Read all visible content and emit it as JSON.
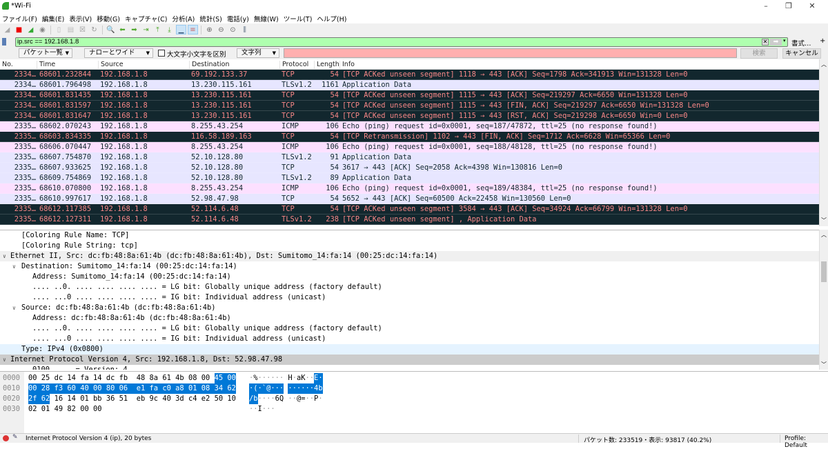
{
  "window": {
    "title": "*Wi-Fi",
    "controls": [
      "–",
      "❐",
      "✕"
    ]
  },
  "menu": [
    "ファイル(F)",
    "編集(E)",
    "表示(V)",
    "移動(G)",
    "キャプチャ(C)",
    "分析(A)",
    "統計(S)",
    "電話(y)",
    "無線(W)",
    "ツール(T)",
    "ヘルプ(H)"
  ],
  "toolbar": [
    "shark-fin-start",
    "stop-capture",
    "restart-capture",
    "capture-options",
    "open-file",
    "file",
    "close-file",
    "reload",
    "find-packet",
    "go-back",
    "go-forward",
    "go-to-packet",
    "go-first",
    "go-last",
    "auto-scroll",
    "colorize",
    "zoom-in",
    "zoom-out",
    "zoom-normal",
    "resize-columns"
  ],
  "filter": {
    "value": "ip.src == 192.168.1.8",
    "format_label": "書式…",
    "add_label": "+",
    "color": "#afffaf"
  },
  "find": {
    "scope": "パケット一覧",
    "charset": "ナローとワイド",
    "case_label": "大文字小文字を区別",
    "case_checked": false,
    "type": "文字列",
    "value": "",
    "search_label": "検索",
    "cancel_label": "キャンセル",
    "input_color": "#ffafaf"
  },
  "packet_list": {
    "columns": [
      "No.",
      "Time",
      "Source",
      "Destination",
      "Protocol",
      "Length",
      "Info"
    ],
    "colors": {
      "dark_bg": "#12272e",
      "dark_fg": "#f78787",
      "tcp_bg": "#e7e6ff",
      "icmp_bg": "#fce0ff",
      "light_fg": "#12272e"
    },
    "rows": [
      {
        "no": "2334…",
        "time": "68601.232844",
        "src": "192.168.1.8",
        "dst": "69.192.133.37",
        "proto": "TCP",
        "len": "54",
        "info": "[TCP ACKed unseen segment] 1118 → 443 [ACK] Seq=1798 Ack=341913 Win=131328 Len=0",
        "style": "dark"
      },
      {
        "no": "2334…",
        "time": "68601.796498",
        "src": "192.168.1.8",
        "dst": "13.230.115.161",
        "proto": "TLSv1.2",
        "len": "1161",
        "info": "Application Data",
        "style": "tcp"
      },
      {
        "no": "2334…",
        "time": "68601.831435",
        "src": "192.168.1.8",
        "dst": "13.230.115.161",
        "proto": "TCP",
        "len": "54",
        "info": "[TCP ACKed unseen segment] 1115 → 443 [ACK] Seq=219297 Ack=6650 Win=131328 Len=0",
        "style": "dark"
      },
      {
        "no": "2334…",
        "time": "68601.831597",
        "src": "192.168.1.8",
        "dst": "13.230.115.161",
        "proto": "TCP",
        "len": "54",
        "info": "[TCP ACKed unseen segment] 1115 → 443 [FIN, ACK] Seq=219297 Ack=6650 Win=131328 Len=0",
        "style": "dark"
      },
      {
        "no": "2334…",
        "time": "68601.831647",
        "src": "192.168.1.8",
        "dst": "13.230.115.161",
        "proto": "TCP",
        "len": "54",
        "info": "[TCP ACKed unseen segment] 1115 → 443 [RST, ACK] Seq=219298 Ack=6650 Win=0 Len=0",
        "style": "dark"
      },
      {
        "no": "2335…",
        "time": "68602.070243",
        "src": "192.168.1.8",
        "dst": "8.255.43.254",
        "proto": "ICMP",
        "len": "106",
        "info": "Echo (ping) request  id=0x0001, seq=187/47872, ttl=25 (no response found!)",
        "style": "icmp"
      },
      {
        "no": "2335…",
        "time": "68603.834335",
        "src": "192.168.1.8",
        "dst": "116.58.189.163",
        "proto": "TCP",
        "len": "54",
        "info": "[TCP Retransmission] 1102 → 443 [FIN, ACK] Seq=1712 Ack=6628 Win=65366 Len=0",
        "style": "dark"
      },
      {
        "no": "2335…",
        "time": "68606.070447",
        "src": "192.168.1.8",
        "dst": "8.255.43.254",
        "proto": "ICMP",
        "len": "106",
        "info": "Echo (ping) request  id=0x0001, seq=188/48128, ttl=25 (no response found!)",
        "style": "icmp"
      },
      {
        "no": "2335…",
        "time": "68607.754870",
        "src": "192.168.1.8",
        "dst": "52.10.128.80",
        "proto": "TLSv1.2",
        "len": "91",
        "info": "Application Data",
        "style": "tcp"
      },
      {
        "no": "2335…",
        "time": "68607.933625",
        "src": "192.168.1.8",
        "dst": "52.10.128.80",
        "proto": "TCP",
        "len": "54",
        "info": "3617 → 443 [ACK] Seq=2058 Ack=4398 Win=130816 Len=0",
        "style": "tcp"
      },
      {
        "no": "2335…",
        "time": "68609.754869",
        "src": "192.168.1.8",
        "dst": "52.10.128.80",
        "proto": "TLSv1.2",
        "len": "89",
        "info": "Application Data",
        "style": "tcp"
      },
      {
        "no": "2335…",
        "time": "68610.070800",
        "src": "192.168.1.8",
        "dst": "8.255.43.254",
        "proto": "ICMP",
        "len": "106",
        "info": "Echo (ping) request  id=0x0001, seq=189/48384, ttl=25 (no response found!)",
        "style": "icmp"
      },
      {
        "no": "2335…",
        "time": "68610.997617",
        "src": "192.168.1.8",
        "dst": "52.98.47.98",
        "proto": "TCP",
        "len": "54",
        "info": "5652 → 443 [ACK] Seq=60500 Ack=22458 Win=130560 Len=0",
        "style": "tcp"
      },
      {
        "no": "2335…",
        "time": "68612.117385",
        "src": "192.168.1.8",
        "dst": "52.114.6.48",
        "proto": "TCP",
        "len": "54",
        "info": "[TCP ACKed unseen segment] 3584 → 443 [ACK] Seq=34924 Ack=66799 Win=131328 Len=0",
        "style": "dark"
      },
      {
        "no": "2335…",
        "time": "68612.127311",
        "src": "192.168.1.8",
        "dst": "52.114.6.48",
        "proto": "TLSv1.2",
        "len": "238",
        "info": "[TCP ACKed unseen segment] , Application Data",
        "style": "dark"
      }
    ]
  },
  "details": [
    {
      "text": "[Coloring Rule Name: TCP]",
      "level": 2,
      "expander": false
    },
    {
      "text": "[Coloring Rule String: tcp]",
      "level": 2,
      "expander": false
    },
    {
      "text": "Ethernet II, Src: dc:fb:48:8a:61:4b (dc:fb:48:8a:61:4b), Dst: Sumitomo_14:fa:14 (00:25:dc:14:fa:14)",
      "level": 0,
      "expander": true,
      "state": "hover"
    },
    {
      "text": "Destination: Sumitomo_14:fa:14 (00:25:dc:14:fa:14)",
      "level": 1,
      "expander": true
    },
    {
      "text": "Address: Sumitomo_14:fa:14 (00:25:dc:14:fa:14)",
      "level": 3,
      "expander": false
    },
    {
      "text": ".... ..0. .... .... .... .... = LG bit: Globally unique address (factory default)",
      "level": 3,
      "expander": false
    },
    {
      "text": ".... ...0 .... .... .... .... = IG bit: Individual address (unicast)",
      "level": 3,
      "expander": false
    },
    {
      "text": "Source: dc:fb:48:8a:61:4b (dc:fb:48:8a:61:4b)",
      "level": 1,
      "expander": true
    },
    {
      "text": "Address: dc:fb:48:8a:61:4b (dc:fb:48:8a:61:4b)",
      "level": 3,
      "expander": false
    },
    {
      "text": ".... ..0. .... .... .... .... = LG bit: Globally unique address (factory default)",
      "level": 3,
      "expander": false
    },
    {
      "text": ".... ...0 .... .... .... .... = IG bit: Individual address (unicast)",
      "level": 3,
      "expander": false
    },
    {
      "text": "Type: IPv4 (0x0800)",
      "level": 2,
      "expander": false,
      "state": "related"
    },
    {
      "text": "Internet Protocol Version 4, Src: 192.168.1.8, Dst: 52.98.47.98",
      "level": 0,
      "expander": true,
      "state": "selected"
    },
    {
      "text": "0100 .... = Version: 4",
      "level": 3,
      "expander": false
    }
  ],
  "hex": {
    "selected_bytes": [
      14,
      33
    ],
    "rows": [
      {
        "offset": "0000",
        "bytes": [
          "00",
          "25",
          "dc",
          "14",
          "fa",
          "14",
          "dc",
          "fb",
          "48",
          "8a",
          "61",
          "4b",
          "08",
          "00",
          "45",
          "00"
        ],
        "ascii": "·%······H·aK··E·"
      },
      {
        "offset": "0010",
        "bytes": [
          "00",
          "28",
          "f3",
          "60",
          "40",
          "00",
          "80",
          "06",
          "e1",
          "fa",
          "c0",
          "a8",
          "01",
          "08",
          "34",
          "62"
        ],
        "ascii": "·(·`@·········4b"
      },
      {
        "offset": "0020",
        "bytes": [
          "2f",
          "62",
          "16",
          "14",
          "01",
          "bb",
          "36",
          "51",
          "eb",
          "9c",
          "40",
          "3d",
          "c4",
          "e2",
          "50",
          "10"
        ],
        "ascii": "/b····6Q··@=··P·"
      },
      {
        "offset": "0030",
        "bytes": [
          "02",
          "01",
          "49",
          "82",
          "00",
          "00"
        ],
        "ascii": "··I···"
      }
    ]
  },
  "status": {
    "field_info": "Internet Protocol Version 4 (ip), 20 bytes",
    "packets": "パケット数: 233519・表示: 93817 (40.2%)",
    "profile": "Profile: Default"
  }
}
